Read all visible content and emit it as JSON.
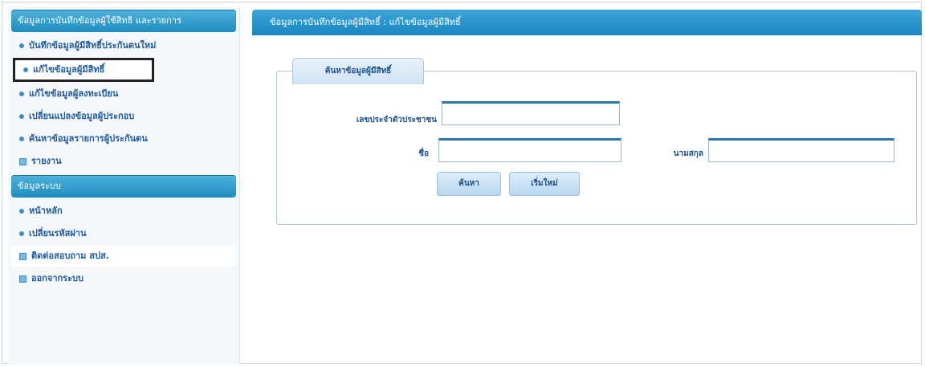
{
  "sidebar": {
    "section1_title": "ข้อมูลการบันทึกข้อมูลผู้ใช้สิทธิ และรายการ",
    "items1": [
      {
        "label": "บันทึกข้อมูลผู้มีสิทธิ์ประกันตนใหม่",
        "icon": "dot"
      },
      {
        "label": "แก้ไขข้อมูลผู้มีสิทธิ์",
        "icon": "dot",
        "selected": true
      },
      {
        "label": "แก้ไขข้อมูลผู้ลงทะเบียน",
        "icon": "dot"
      },
      {
        "label": "เปลี่ยนแปลงข้อมูลผู้ประกอบ",
        "icon": "dot"
      },
      {
        "label": "ค้นหาข้อมูลรายการผู้ประกันตน",
        "icon": "dot"
      },
      {
        "label": "รายงาน",
        "icon": "square"
      }
    ],
    "section2_title": "ข้อมูลระบบ",
    "items2": [
      {
        "label": "หน้าหลัก",
        "icon": "dot"
      },
      {
        "label": "เปลี่ยนรหัสผ่าน",
        "icon": "dot"
      },
      {
        "label": "ติดต่อสอบถาม สปส.",
        "icon": "square",
        "light": true
      },
      {
        "label": "ออกจากระบบ",
        "icon": "square"
      }
    ]
  },
  "main": {
    "header": "ข้อมูลการบันทึกข้อมูลผู้มีสิทธิ์ : แก้ไขข้อมูลผู้มีสิทธิ์",
    "tab": "ค้นหาข้อมูลผู้มีสิทธิ์",
    "form": {
      "id_label": "เลขประจำตัวประชาชน",
      "id_value": "",
      "name_label": "ชื่อ",
      "name_value": "",
      "surname_label": "นามสกุล",
      "surname_value": "",
      "search_button": "ค้นหา",
      "clear_button": "เริ่มใหม่"
    }
  },
  "colors": {
    "accent": "#1f8dc0",
    "text": "#1b4f8a",
    "selected_border": "#222222"
  }
}
